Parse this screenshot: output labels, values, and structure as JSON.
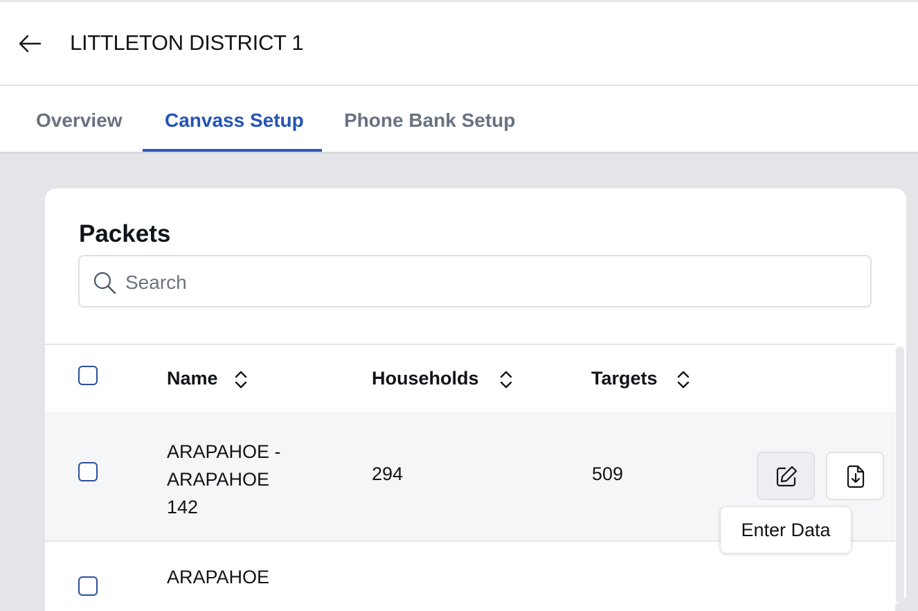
{
  "header": {
    "title": "LITTLETON DISTRICT 1"
  },
  "tabs": [
    {
      "label": "Overview"
    },
    {
      "label": "Canvass Setup"
    },
    {
      "label": "Phone Bank Setup"
    }
  ],
  "active_tab": "Canvass Setup",
  "packets": {
    "title": "Packets",
    "search_placeholder": "Search",
    "columns": [
      "Name",
      "Households",
      "Targets"
    ],
    "rows": [
      {
        "name": "ARAPAHOE - ARAPAHOE 142",
        "name_lines": [
          "ARAPAHOE -",
          "ARAPAHOE",
          "142"
        ],
        "households": "294",
        "targets": "509"
      },
      {
        "name_partial": "ARAPAHOE"
      }
    ],
    "tooltip": "Enter Data"
  },
  "colors": {
    "accent": "#2552b5",
    "muted_tab": "#69727f",
    "page_bg": "#e4e5e8",
    "row_hover": "#f5f6f8"
  },
  "icons": [
    "arrow-left-icon",
    "search-icon",
    "sort-icon",
    "edit-icon",
    "file-download-icon"
  ]
}
